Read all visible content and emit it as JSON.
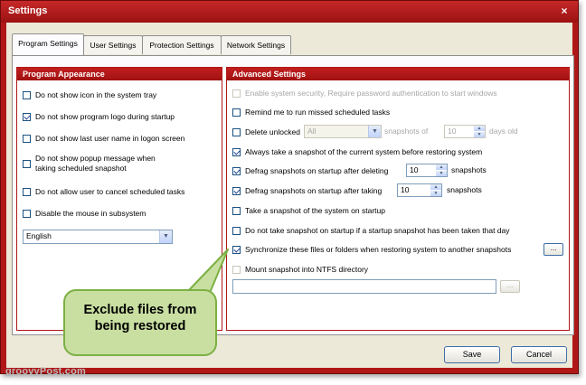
{
  "window": {
    "title": "Settings",
    "close_glyph": "×"
  },
  "tabs": [
    {
      "label": "Program Settings",
      "active": true
    },
    {
      "label": "User Settings",
      "active": false
    },
    {
      "label": "Protection Settings",
      "active": false
    },
    {
      "label": "Network Settings",
      "active": false
    }
  ],
  "program_appearance": {
    "header": "Program Appearance",
    "items": [
      {
        "label": "Do not show icon in the system tray",
        "checked": false
      },
      {
        "label": "Do not show program logo during startup",
        "checked": true
      },
      {
        "label": "Do not show last user name in logon screen",
        "checked": false
      },
      {
        "label_line1": "Do not show popup message when",
        "label_line2": "taking scheduled snapshot",
        "checked": false
      },
      {
        "label": "Do not allow user to cancel scheduled tasks",
        "checked": false
      },
      {
        "label": "Disable the mouse in subsystem",
        "checked": false
      }
    ],
    "language": {
      "value": "English"
    }
  },
  "advanced_settings": {
    "header": "Advanced Settings",
    "security": {
      "label": "Enable system security, Require password authentication to start windows",
      "checked": false,
      "disabled": true
    },
    "remind": {
      "label": "Remind me to run missed scheduled tasks",
      "checked": false
    },
    "delete_unlocked": {
      "label": "Delete unlocked",
      "checked": false,
      "combo_value": "All",
      "mid_text": "snapshots of",
      "spin_value": "10",
      "suffix": "days old"
    },
    "always_take": {
      "label": "Always take a snapshot of the current system before restoring system",
      "checked": true
    },
    "defrag_delete": {
      "label": "Defrag snapshots on startup after deleting",
      "checked": true,
      "spin_value": "10",
      "suffix": "snapshots"
    },
    "defrag_take": {
      "label": "Defrag snapshots on startup after taking",
      "checked": true,
      "spin_value": "10",
      "suffix": "snapshots"
    },
    "take_startup": {
      "label": "Take a snapshot of the system on startup",
      "checked": false
    },
    "no_take_startup": {
      "label": "Do not take snapshot on startup if a startup snapshot has been taken that day",
      "checked": false
    },
    "synchronize": {
      "label": "Synchronize these files or folders when restoring system to another snapshots",
      "checked": true,
      "button": "..."
    },
    "mount": {
      "label": "Mount snapshot into NTFS directory",
      "checked": false,
      "path_value": "",
      "button": "..."
    }
  },
  "buttons": {
    "save": "Save",
    "cancel": "Cancel"
  },
  "callout": {
    "line1": "Exclude files from",
    "line2": "being restored"
  },
  "watermark": "groovyPost.com",
  "colors": {
    "accent": "#b01818",
    "callout_fill": "#c8dfa1",
    "callout_border": "#7cb044",
    "dialog_bg": "#ece9d8"
  }
}
